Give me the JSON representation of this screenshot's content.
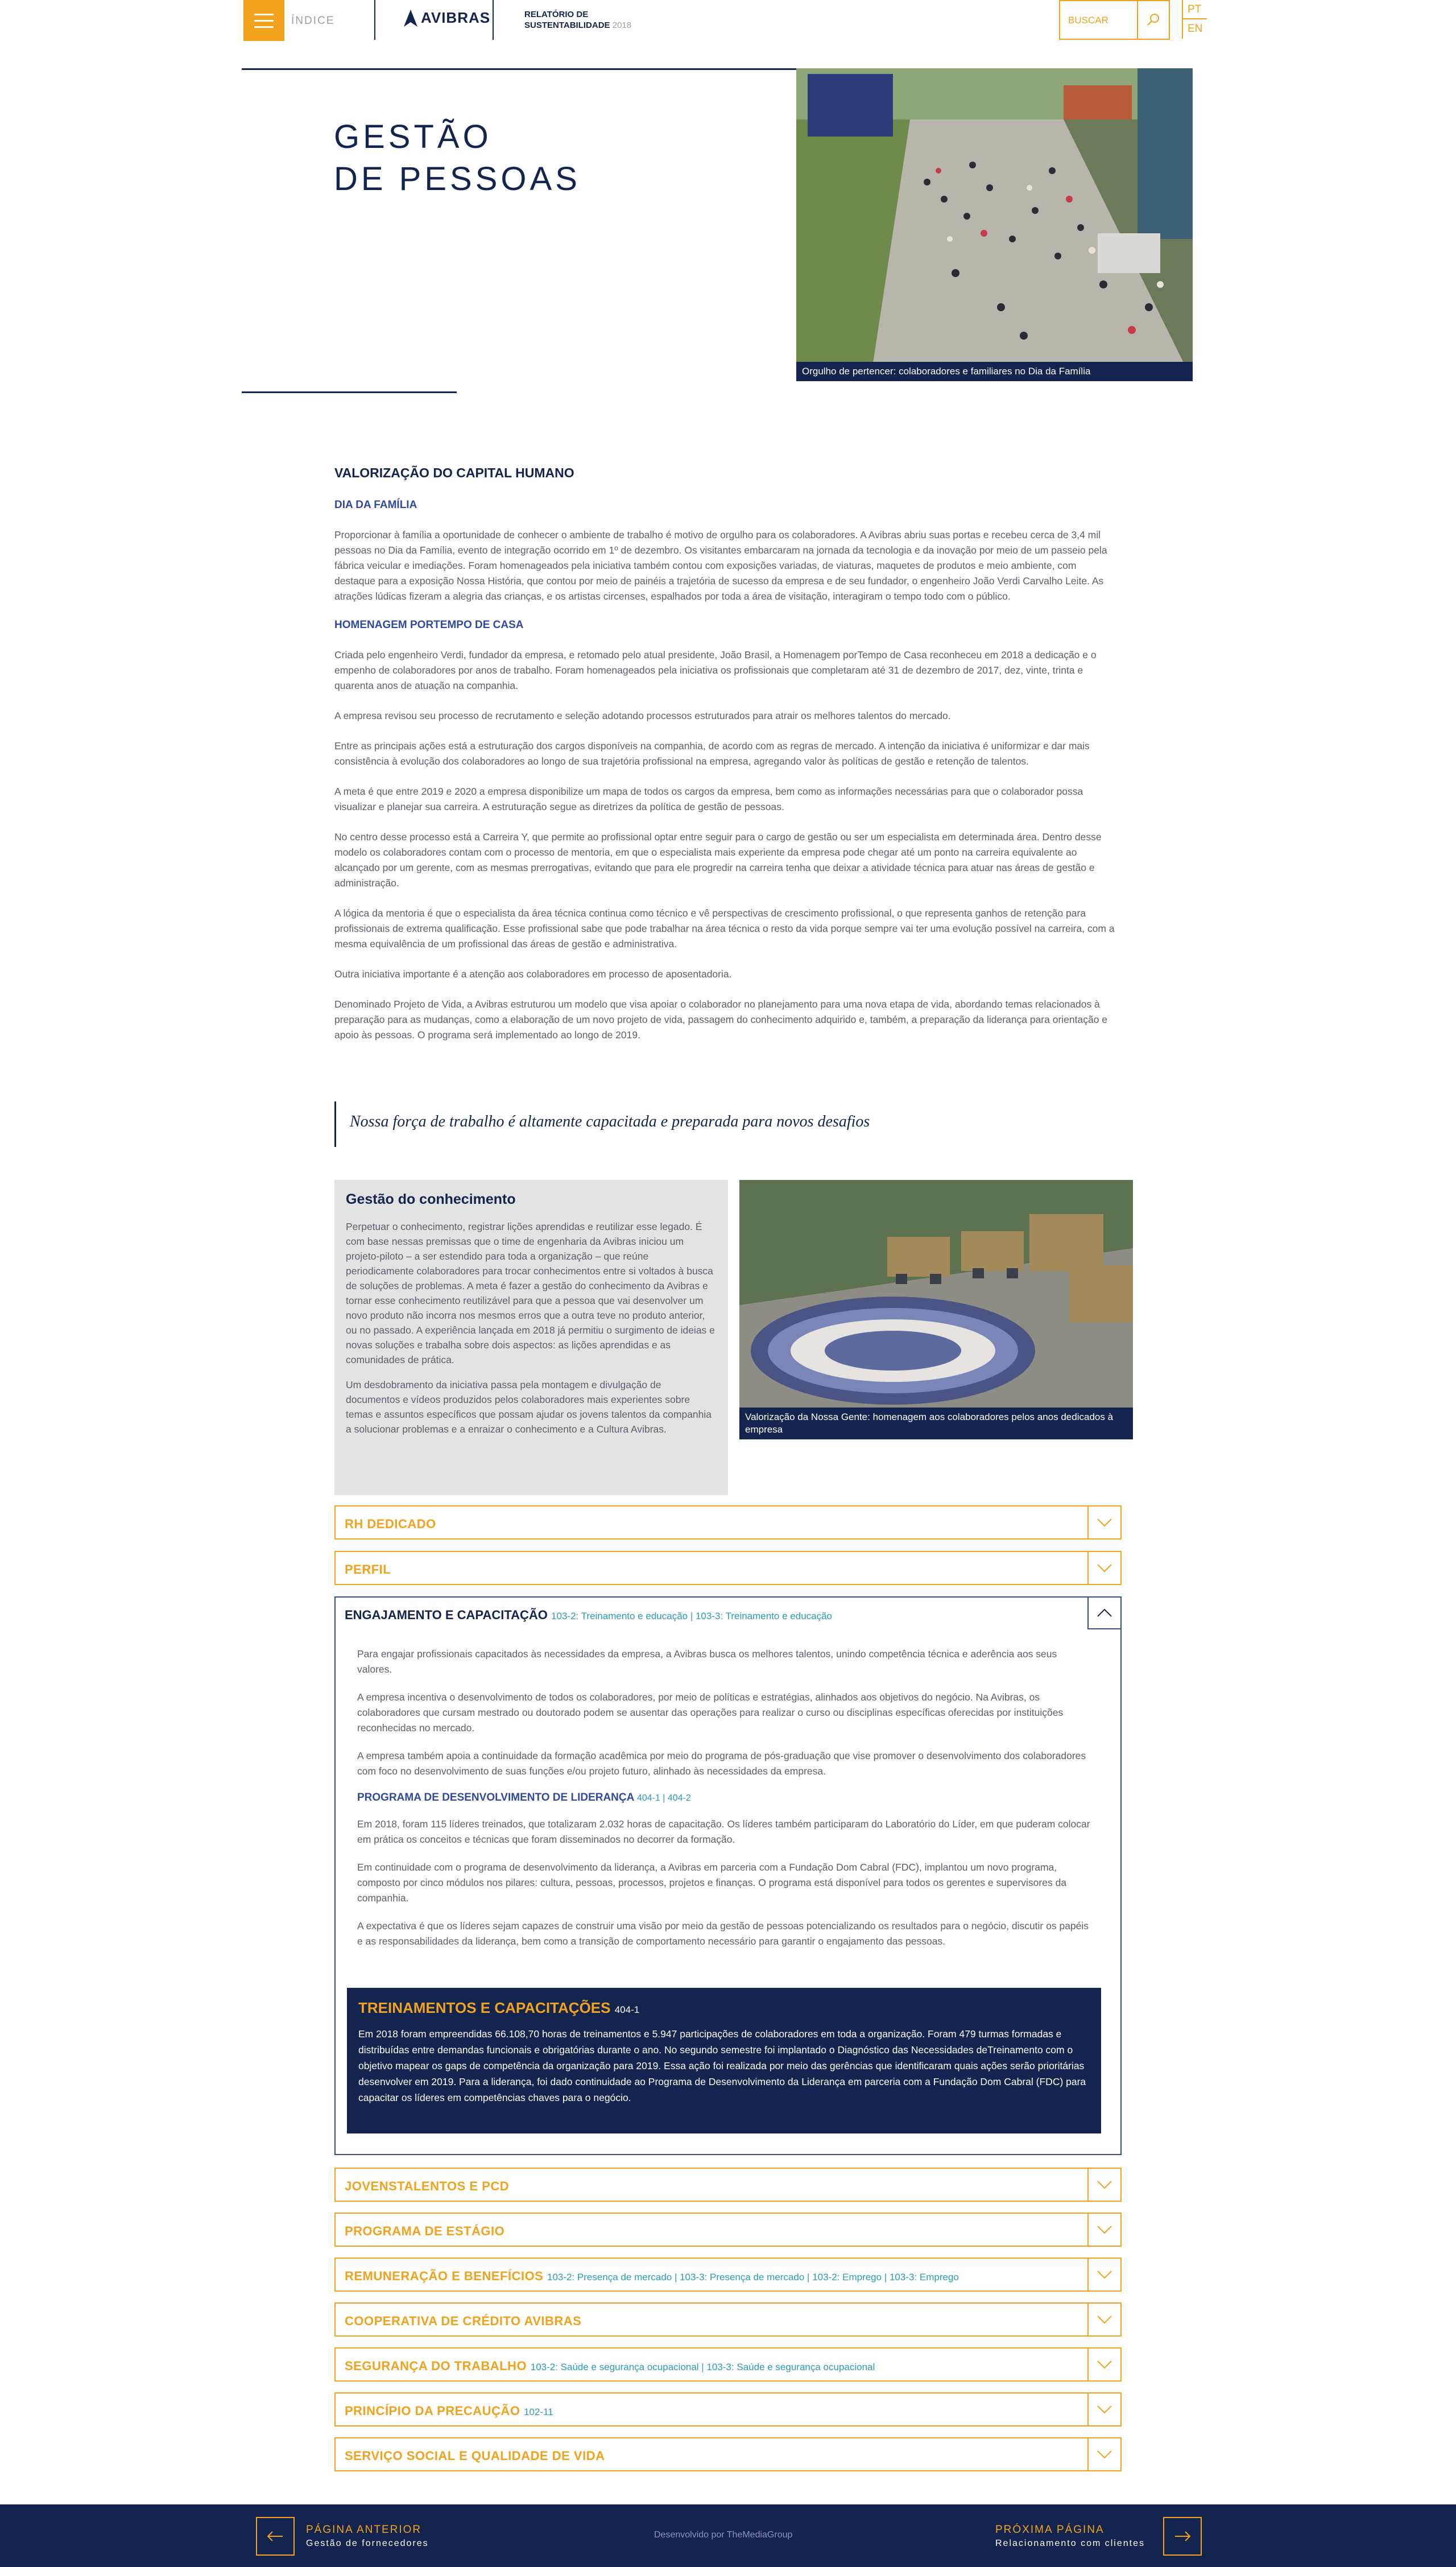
{
  "header": {
    "index_label": "ÍNDICE",
    "logo_text": "AVIBRAS",
    "report_line1": "RELATÓRIO DE",
    "report_line2": "SUSTENTABILIDADE",
    "report_year": "2018",
    "search_placeholder": "BUSCAR",
    "lang_pt": "PT",
    "lang_en": "EN"
  },
  "hero": {
    "title_line1": "GESTÃO",
    "title_line2": "DE PESSOAS",
    "image_caption": "Orgulho de pertencer: colaboradores e familiares no Dia da Família"
  },
  "main": {
    "section_title": "VALORIZAÇÃO DO CAPITAL HUMANO",
    "sub1": "DIA DA FAMÍLIA",
    "p1": "Proporcionar à família a oportunidade de conhecer o ambiente de trabalho é motivo de orgulho para os colaboradores. A Avibras abriu suas portas e recebeu cerca de 3,4 mil pessoas no Dia da Família, evento de integração ocorrido em 1º de dezembro. Os visitantes embarcaram na jornada da tecnologia e da inovação por meio de um passeio pela fábrica veicular e imediações. Foram homenageados pela iniciativa também contou com exposições variadas, de viaturas, maquetes de produtos e meio ambiente, com destaque para a exposição Nossa História, que contou por meio de painéis a trajetória de sucesso da empresa e de seu fundador, o engenheiro João Verdi Carvalho Leite. As atrações lúdicas fizeram a alegria das crianças, e os artistas circenses, espalhados por toda a área de visitação, interagiram o tempo todo com o público.",
    "sub2": "HOMENAGEM PORTEMPO DE CASA",
    "p2": "Criada pelo engenheiro Verdi, fundador da empresa, e retomado pelo atual presidente, João Brasil, a Homenagem porTempo de Casa reconheceu em 2018 a dedicação e o empenho de colaboradores por anos de trabalho. Foram homenageados pela iniciativa os profissionais que completaram até 31 de dezembro de 2017, dez, vinte, trinta e quarenta anos de atuação na companhia.",
    "p3": "A empresa revisou seu processo de recrutamento e seleção adotando processos estruturados para atrair os melhores talentos do mercado.",
    "p4": "Entre as principais ações está a estruturação dos cargos disponíveis na companhia, de acordo com as regras de mercado. A intenção da iniciativa é uniformizar e dar mais consistência à evolução dos colaboradores ao longo de sua trajetória profissional na empresa, agregando valor às políticas de gestão e retenção de talentos.",
    "p5": "A meta é que entre 2019 e 2020 a empresa disponibilize um mapa de todos os cargos da empresa, bem como as informações necessárias para que o colaborador possa visualizar e planejar sua carreira. A estruturação segue as diretrizes da política de gestão de pessoas.",
    "p6": "No centro desse processo está a Carreira Y, que permite ao profissional optar entre seguir para o cargo de gestão ou ser um especialista em determinada área. Dentro desse modelo os colaboradores contam com o processo de mentoria, em que o especialista mais experiente da empresa pode chegar até um ponto na carreira equivalente ao alcançado por um gerente, com as mesmas prerrogativas, evitando que para ele progredir na carreira tenha que deixar a atividade técnica para atuar nas áreas de gestão e administração.",
    "p7": "A lógica da mentoria é que o especialista da área técnica continua como técnico e vê perspectivas de crescimento profissional, o que representa ganhos de retenção para profissionais de extrema qualificação. Esse profissional sabe que pode trabalhar na área técnica o resto da vida porque sempre vai ter uma evolução possível na carreira, com a mesma equivalência de um profissional das áreas de gestão e administrativa.",
    "p8": "Outra iniciativa importante é a atenção aos colaboradores em processo de aposentadoria.",
    "p9": "Denominado Projeto de Vida, a Avibras estruturou um modelo que visa apoiar o colaborador no planejamento para uma nova etapa de vida, abordando temas relacionados à preparação para as mudanças, como a elaboração de um novo projeto de vida, passagem do conhecimento adquirido e, também, a preparação da liderança para orientação e apoio às pessoas. O programa será implementado ao longo de 2019."
  },
  "quote": "Nossa força de trabalho é altamente capacitada e preparada para novos desafios",
  "gestao": {
    "title": "Gestão do conhecimento",
    "p1": "Perpetuar o conhecimento, registrar lições aprendidas e reutilizar esse legado. É com base nessas premissas que o time de engenharia da Avibras iniciou um projeto-piloto – a ser estendido para toda a organização – que reúne periodicamente colaboradores para trocar conhecimentos entre si voltados à busca de soluções de problemas. A meta é fazer a gestão do conhecimento da Avibras e tornar esse conhecimento reutilizável para que a pessoa que vai desenvolver um novo produto não incorra nos mesmos erros que a outra teve no produto anterior, ou no passado. A experiência lançada em 2018 já permitiu o surgimento de ideias e novas soluções e trabalha sobre dois aspectos: as lições aprendidas e as comunidades de prática.",
    "p2": "Um desdobramento da iniciativa passa pela montagem e divulgação de documentos e vídeos produzidos pelos colaboradores mais experientes sobre temas e assuntos específicos que possam ajudar os jovens talentos da companhia a solucionar problemas e a enraizar o conhecimento e a Cultura Avibras.",
    "image_caption": "Valorização da Nossa Gente: homenagem aos colaboradores pelos anos dedicados à empresa"
  },
  "accordion": {
    "rh": "RH DEDICADO",
    "perfil": "PERFIL",
    "eng_title": "ENGAJAMENTO E CAPACITAÇÃO",
    "eng_ref": "103-2: Treinamento e educação | 103-3: Treinamento e educação",
    "eng_p1": "Para engajar profissionais capacitados às necessidades da empresa, a Avibras busca os melhores talentos, unindo competência técnica e aderência aos seus valores.",
    "eng_p2": "A empresa incentiva o desenvolvimento de todos os colaboradores, por meio de políticas e estratégias, alinhados aos objetivos do negócio. Na Avibras, os colaboradores que cursam mestrado ou doutorado podem se ausentar das operações para realizar o curso ou disciplinas específicas oferecidas por instituições reconhecidas no mercado.",
    "eng_p3": "A empresa também apoia a continuidade da formação acadêmica por meio do programa de pós-graduação que vise promover o desenvolvimento dos colaboradores com foco no desenvolvimento de suas funções e/ou projeto futuro, alinhado às necessidades da empresa.",
    "eng_sub": "PROGRAMA DE DESENVOLVIMENTO DE LIDERANÇA",
    "eng_sub_ref": "404-1 | 404-2",
    "eng_p4": "Em 2018, foram 115 líderes treinados, que totalizaram 2.032 horas de capacitação. Os líderes também participaram do Laboratório do Líder, em que puderam colocar em prática os conceitos e técnicas que foram disseminados no decorrer da formação.",
    "eng_p5": "Em continuidade com o programa de desenvolvimento da liderança, a Avibras em parceria com a Fundação Dom Cabral (FDC), implantou um novo programa, composto por cinco módulos nos pilares: cultura, pessoas, processos, projetos e finanças. O programa está disponível para todos os gerentes e supervisores da companhia.",
    "eng_p6": "A expectativa é que os líderes sejam capazes de construir uma visão por meio da gestão de pessoas potencializando os resultados para o negócio, discutir os papéis e as responsabilidades da liderança, bem como a transição de comportamento necessário para garantir o engajamento das pessoas.",
    "trein_title": "TREINAMENTOS E CAPACITAÇÕES",
    "trein_ref": "404-1",
    "trein_text": "Em 2018 foram empreendidas 66.108,70 horas de treinamentos e 5.947 participações de colaboradores em toda a organização. Foram 479 turmas formadas e distribuídas entre demandas funcionais e obrigatórias durante o ano. No segundo semestre foi implantado o Diagnóstico das Necessidades deTreinamento com o objetivo mapear os gaps de competência da organização para 2019. Essa ação foi realizada por meio das gerências que identificaram quais ações serão prioritárias desenvolver em 2019. Para a liderança, foi dado continuidade ao Programa de Desenvolvimento da Liderança em parceria com a Fundação Dom Cabral (FDC) para capacitar os líderes em competências chaves para o negócio.",
    "jovens": "JOVENSTALENTOS E PCD",
    "estagio": "PROGRAMA DE ESTÁGIO",
    "remun": "REMUNERAÇÃO E BENEFÍCIOS",
    "remun_ref": "103-2: Presença de mercado | 103-3: Presença de mercado | 103-2: Emprego | 103-3: Emprego",
    "coop": "COOPERATIVA DE CRÉDITO AVIBRAS",
    "seg": "SEGURANÇA DO TRABALHO",
    "seg_ref": "103-2: Saúde e segurança ocupacional | 103-3: Saúde e segurança ocupacional",
    "prec": "PRINCÍPIO DA PRECAUÇÃO",
    "prec_ref": "102-11",
    "social": "SERVIÇO SOCIAL E QUALIDADE DE VIDA"
  },
  "footer": {
    "prev_label": "PÁGINA ANTERIOR",
    "prev_page": "Gestão de fornecedores",
    "dev": "Desenvolvido por TheMediaGroup",
    "next_label": "PRÓXIMA PÁGINA",
    "next_page": "Relacionamento com clientes"
  },
  "colors": {
    "navy": "#13254f",
    "orange": "#f2a21d",
    "teal": "#2a9bb8"
  }
}
